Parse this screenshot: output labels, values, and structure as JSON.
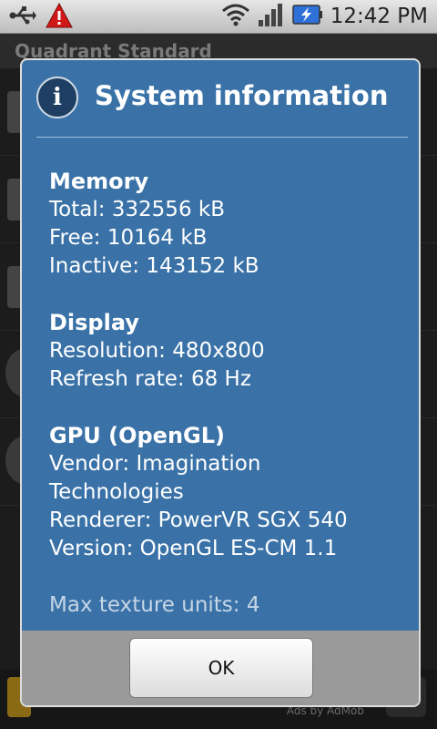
{
  "status_bar": {
    "time": "12:42 PM",
    "icons": [
      "usb-icon",
      "warning-icon",
      "wifi-icon",
      "signal-icon",
      "battery-charging-icon"
    ]
  },
  "app": {
    "title": "Quadrant Standard",
    "ad_text": "Ads by AdMob"
  },
  "dialog": {
    "icon": "info-icon",
    "title": "System information",
    "sections": [
      {
        "title": "Memory",
        "lines": [
          "Total: 332556 kB",
          "Free: 10164 kB",
          "Inactive: 143152 kB"
        ]
      },
      {
        "title": "Display",
        "lines": [
          "Resolution: 480x800",
          "Refresh rate: 68 Hz"
        ]
      },
      {
        "title": "GPU (OpenGL)",
        "lines": [
          "Vendor: Imagination",
          "Technologies",
          "Renderer: PowerVR SGX 540",
          "Version: OpenGL ES-CM 1.1"
        ]
      }
    ],
    "trailing_line": "Max texture units: 4",
    "ok_label": "OK"
  }
}
